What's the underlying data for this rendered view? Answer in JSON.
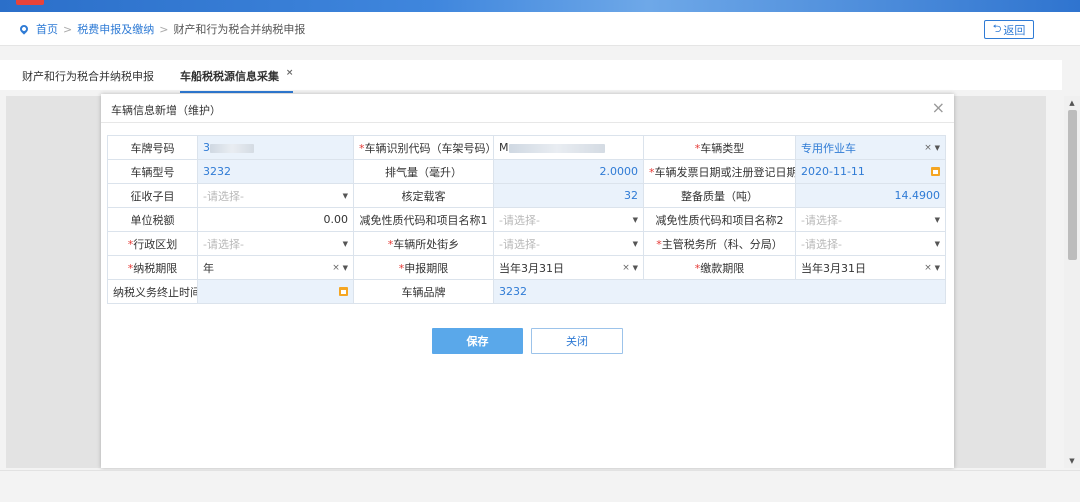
{
  "breadcrumb": {
    "home": "首页",
    "sep": ">",
    "level2": "税费申报及缴纳",
    "current": "财产和行为税合并纳税申报"
  },
  "back_button": "返回",
  "tabs": [
    {
      "label": "财产和行为税合并纳税申报"
    },
    {
      "label": "车船税税源信息采集",
      "close": "×"
    }
  ],
  "modal": {
    "title": "车辆信息新增（维护）",
    "close": "×",
    "required_mark": "*",
    "placeholder": "-请选择-",
    "fields": {
      "plate_label": "车牌号码",
      "plate_value": "3",
      "vin_label": "车辆识别代码（车架号码）",
      "vin_value": "M",
      "type_label": "车辆类型",
      "type_value": "专用作业车",
      "model_label": "车辆型号",
      "model_value": "3232",
      "displacement_label": "排气量（毫升）",
      "displacement_value": "2.0000",
      "regdate_label": "车辆发票日期或注册登记日期",
      "regdate_value": "2020-11-11",
      "subitem_label": "征收子目",
      "seats_label": "核定载客",
      "seats_value": "32",
      "mass_label": "整备质量（吨）",
      "mass_value": "14.4900",
      "unit_tax_label": "单位税额",
      "unit_tax_value": "0.00",
      "relief1_label": "减免性质代码和项目名称1",
      "relief2_label": "减免性质代码和项目名称2",
      "district_label": "行政区划",
      "street_label": "车辆所处街乡",
      "office_label": "主管税务所（科、分局）",
      "period_label": "纳税期限",
      "period_value": "年",
      "report_label": "申报期限",
      "report_value": "当年3月31日",
      "pay_label": "缴款期限",
      "pay_value": "当年3月31日",
      "end_label": "纳税义务终止时间",
      "brand_label": "车辆品牌",
      "brand_value": "3232"
    },
    "save_button": "保存",
    "close_button": "关闭"
  },
  "icons": {
    "clear": "×",
    "caret": "▼",
    "scroll_up": "▲",
    "scroll_down": "▼"
  },
  "colors": {
    "accent": "#2f7bd5",
    "required": "#e53935",
    "save_bg": "#5aa8ea",
    "cell_bg": "#eaf2fb"
  }
}
